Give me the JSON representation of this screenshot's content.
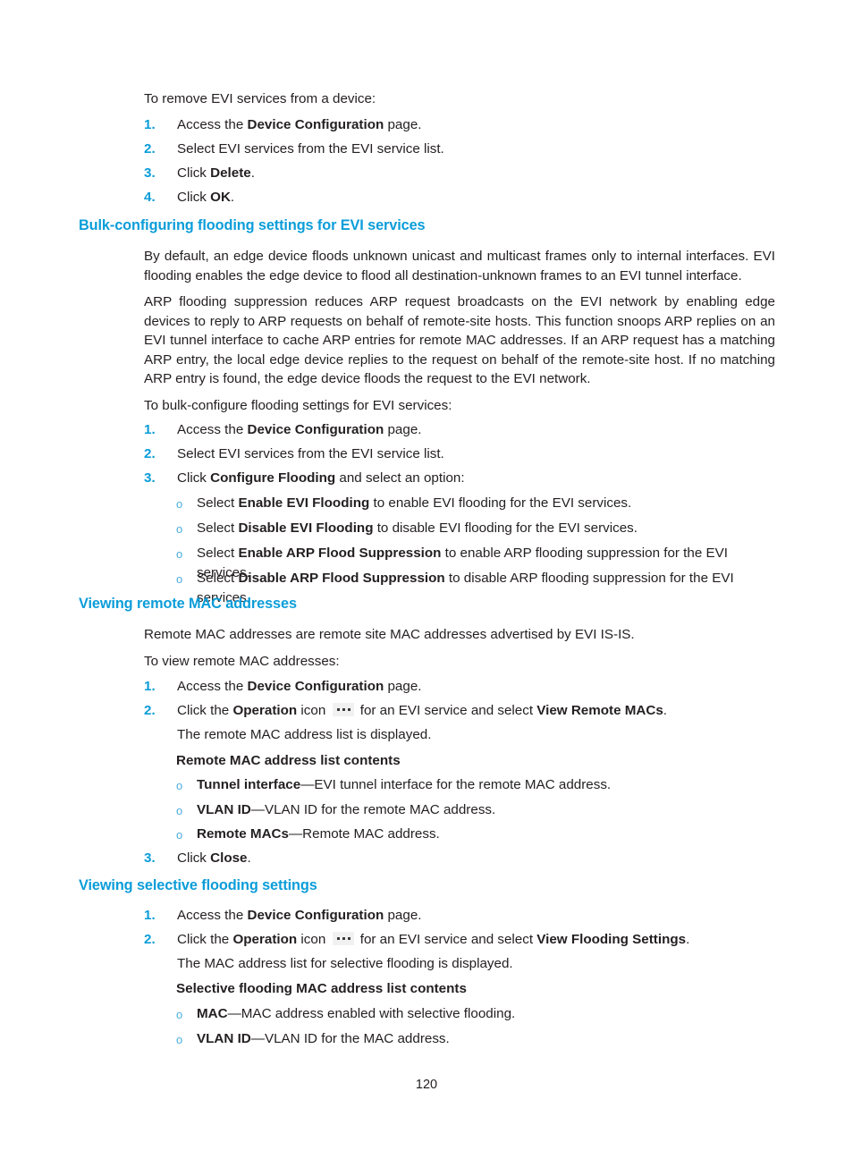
{
  "document": {
    "page_number": "120",
    "accent_color": "#0b9dd9",
    "text_color": "#231f20"
  },
  "intro_remove": {
    "lead": "To remove EVI services from a device:",
    "steps": [
      {
        "num": "1.",
        "pre": "Access the ",
        "bold": "Device Configuration",
        "post": " page."
      },
      {
        "num": "2.",
        "pre": "Select EVI services from the EVI service list.",
        "bold": "",
        "post": ""
      },
      {
        "num": "3.",
        "pre": "Click ",
        "bold": "Delete",
        "post": "."
      },
      {
        "num": "4.",
        "pre": "Click ",
        "bold": "OK",
        "post": "."
      }
    ]
  },
  "section_bulk": {
    "heading": "Bulk-configuring flooding settings for EVI services",
    "paragraph1": "By default, an edge device floods unknown unicast and multicast frames only to internal interfaces. EVI flooding enables the edge device to flood all destination-unknown frames to an EVI tunnel interface.",
    "paragraph2": "ARP flooding suppression reduces ARP request broadcasts on the EVI network by enabling edge devices to reply to ARP requests on behalf of remote-site hosts. This function snoops ARP replies on an EVI tunnel interface to cache ARP entries for remote MAC addresses. If an ARP request has a matching ARP entry, the local edge device replies to the request on behalf of the remote-site host. If no matching ARP entry is found, the edge device floods the request to the EVI network.",
    "lead": "To bulk-configure flooding settings for EVI services:",
    "steps": [
      {
        "num": "1.",
        "pre": "Access the ",
        "bold": "Device Configuration",
        "post": " page."
      },
      {
        "num": "2.",
        "pre": "Select EVI services from the EVI service list.",
        "bold": "",
        "post": ""
      },
      {
        "num": "3.",
        "pre": "Click ",
        "bold": "Configure Flooding",
        "post": " and select an option:"
      }
    ],
    "options": [
      {
        "mark": "o",
        "pre": "Select ",
        "bold": "Enable EVI Flooding",
        "post": " to enable EVI flooding for the EVI services."
      },
      {
        "mark": "o",
        "pre": "Select ",
        "bold": "Disable EVI Flooding",
        "post": " to disable EVI flooding for the EVI services."
      },
      {
        "mark": "o",
        "pre": "Select ",
        "bold": "Enable ARP Flood Suppression",
        "post": " to enable ARP flooding suppression for the EVI services."
      },
      {
        "mark": "o",
        "pre": "Select ",
        "bold": "Disable ARP Flood Suppression",
        "post": " to disable ARP flooding suppression for the EVI services."
      }
    ]
  },
  "section_remote_mac": {
    "heading": "Viewing remote MAC addresses",
    "paragraph1": "Remote MAC addresses are remote site MAC addresses advertised by EVI IS-IS.",
    "lead": "To view remote MAC addresses:",
    "step1": {
      "num": "1.",
      "pre": "Access the ",
      "bold": "Device Configuration",
      "post": " page."
    },
    "step2": {
      "num": "2.",
      "pre": "Click the ",
      "bold1": "Operation",
      "mid1": " icon ",
      "icon": "operation-ellipsis-icon",
      "mid2": " for an EVI service and select ",
      "bold2": "View Remote MACs",
      "post": "."
    },
    "step2_continuation": "The remote MAC address list is displayed.",
    "contents_heading": "Remote MAC address list contents",
    "contents": [
      {
        "mark": "o",
        "bold": "Tunnel interface",
        "post": "—EVI tunnel interface for the remote MAC address."
      },
      {
        "mark": "o",
        "bold": "VLAN ID",
        "post": "—VLAN ID for the remote MAC address."
      },
      {
        "mark": "o",
        "bold": "Remote MACs",
        "post": "—Remote MAC address."
      }
    ],
    "step3": {
      "num": "3.",
      "pre": "Click ",
      "bold": "Close",
      "post": "."
    }
  },
  "section_selective_flooding": {
    "heading": "Viewing selective flooding settings",
    "step1": {
      "num": "1.",
      "pre": "Access the ",
      "bold": "Device Configuration",
      "post": " page."
    },
    "step2": {
      "num": "2.",
      "pre": "Click the ",
      "bold1": "Operation",
      "mid1": " icon ",
      "icon": "operation-ellipsis-icon",
      "mid2": " for an EVI service and select ",
      "bold2": "View Flooding Settings",
      "post": "."
    },
    "step2_continuation": "The MAC address list for selective flooding is displayed.",
    "contents_heading": "Selective flooding MAC address list contents",
    "contents": [
      {
        "mark": "o",
        "bold": "MAC",
        "post": "—MAC address enabled with selective flooding."
      },
      {
        "mark": "o",
        "bold": "VLAN ID",
        "post": "—VLAN ID for the MAC address."
      }
    ]
  }
}
